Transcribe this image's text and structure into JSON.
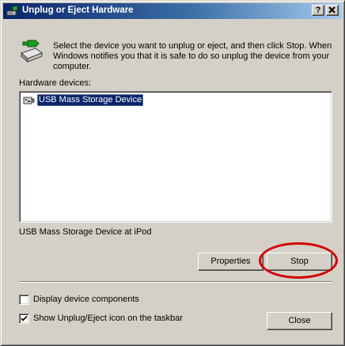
{
  "window": {
    "title": "Unplug or Eject Hardware",
    "help_glyph": "?",
    "close_glyph": "X"
  },
  "header": {
    "icon": "hardware-eject-icon",
    "instructions": "Select the device you want to unplug or eject, and then click Stop. When Windows notifies you that it is safe to do so unplug the device from your computer."
  },
  "devices": {
    "label": "Hardware devices:",
    "items": [
      {
        "label": "USB Mass Storage Device",
        "icon": "usb-device-icon",
        "selected": true
      }
    ],
    "selected_description": "USB Mass Storage Device at iPod"
  },
  "buttons": {
    "properties": "Properties",
    "stop": "Stop",
    "close": "Close"
  },
  "options": {
    "display_components": {
      "label": "Display device components",
      "checked": false
    },
    "show_icon": {
      "label": "Show Unplug/Eject icon on the taskbar",
      "checked": true
    }
  },
  "colors": {
    "titlebar_start": "#0a246a",
    "titlebar_end": "#a6caf0",
    "selection": "#0a246a",
    "annotation": "#d40000",
    "face": "#d4d0c8"
  }
}
